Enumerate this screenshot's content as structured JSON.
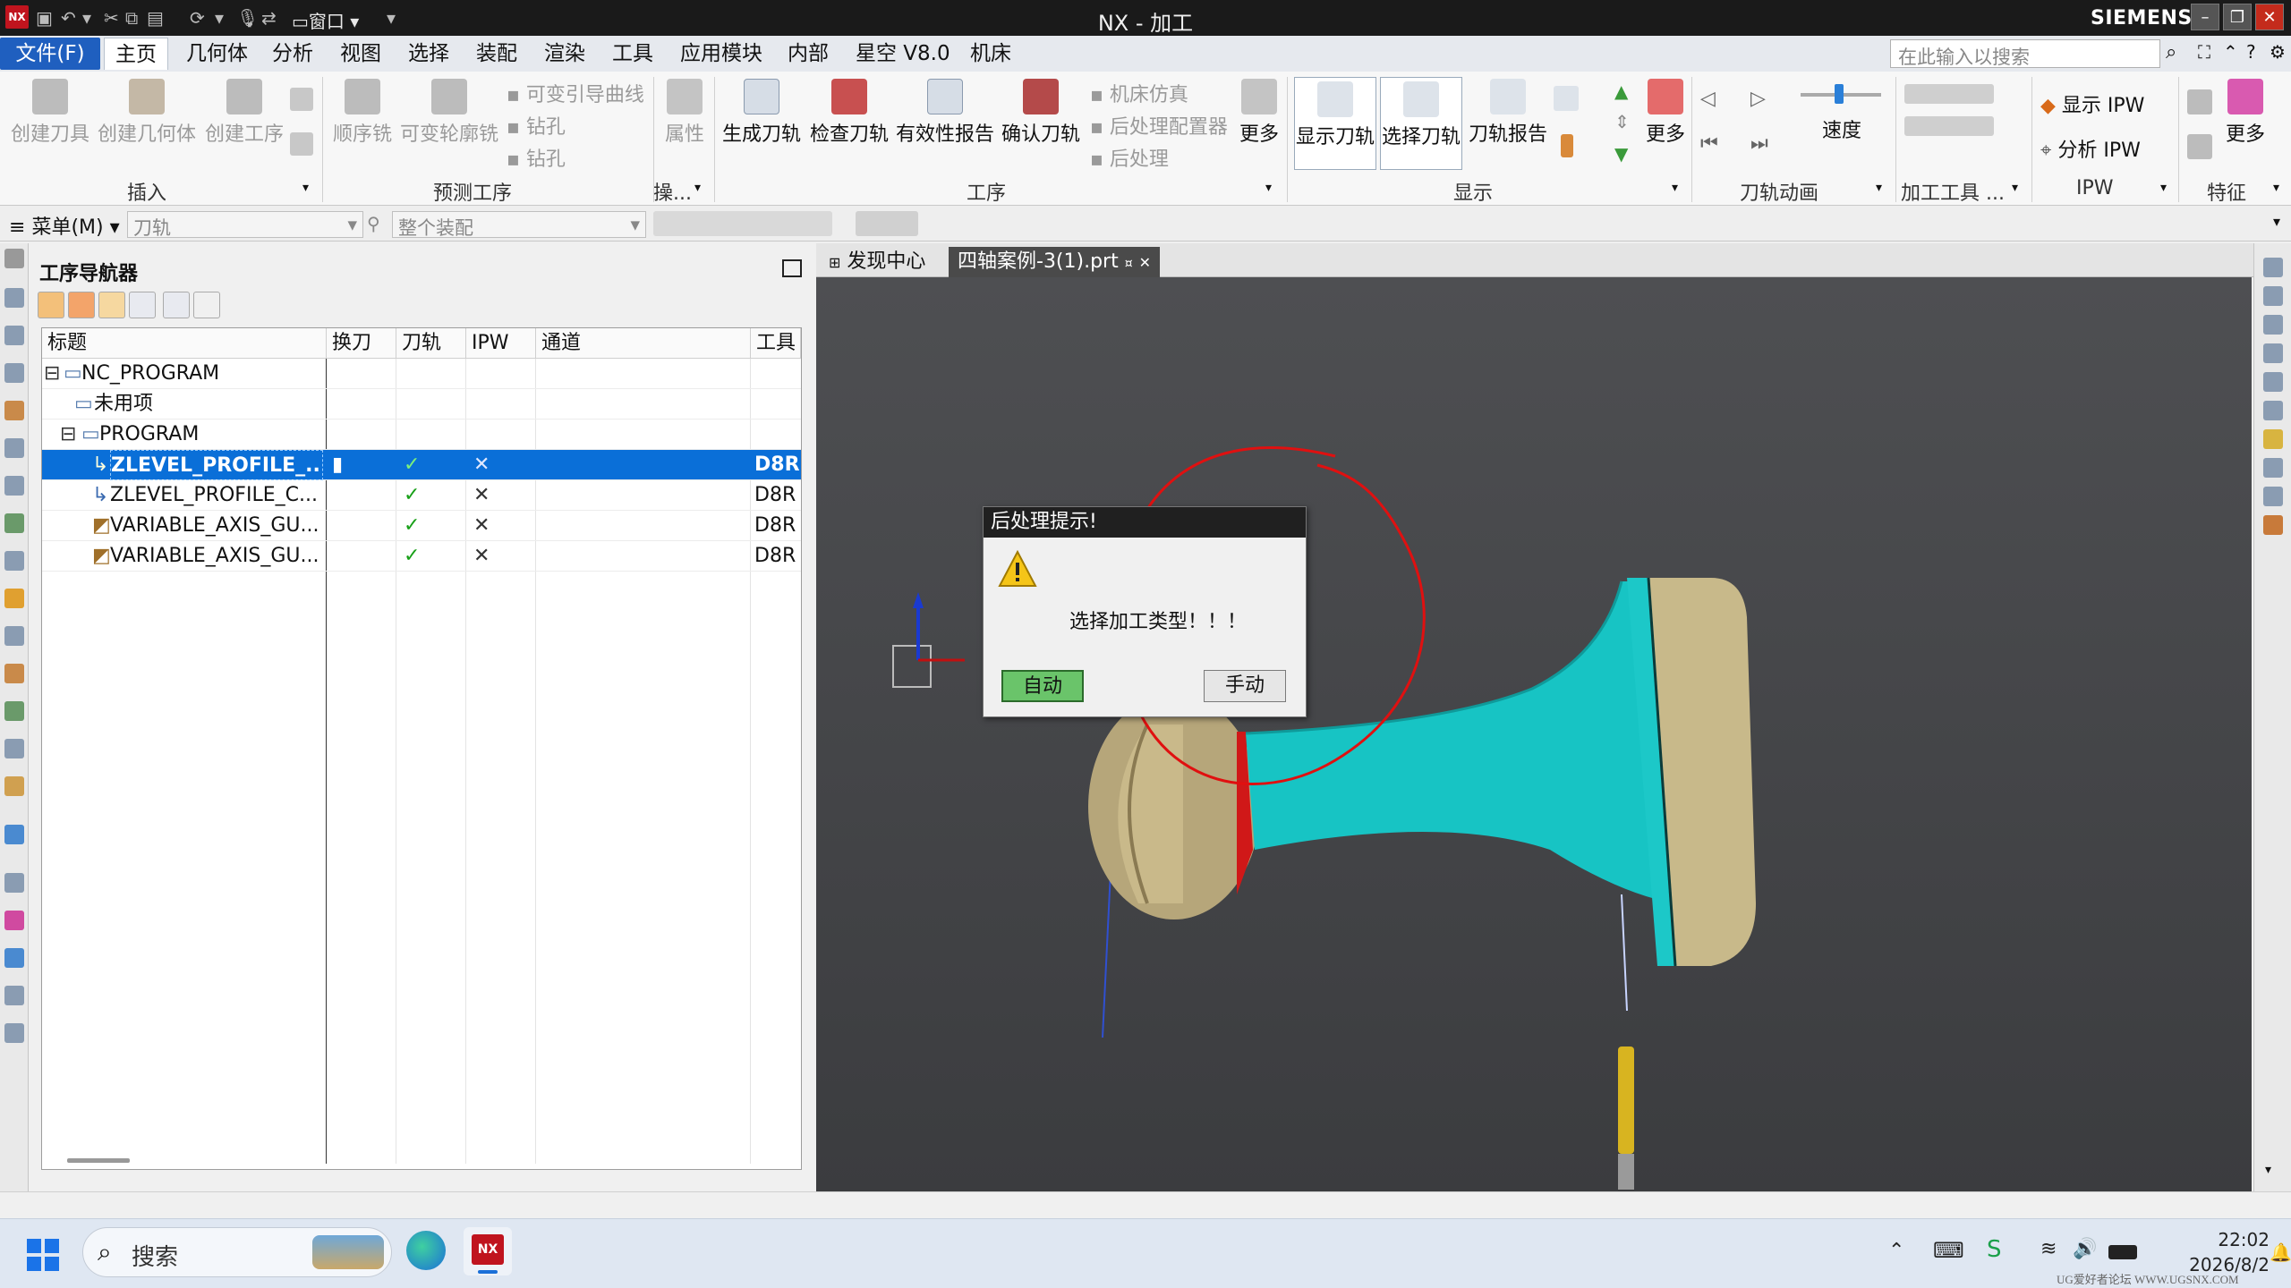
{
  "window": {
    "title": "NX - 加工",
    "brand": "SIEMENS",
    "window_menu": "窗口",
    "colors": {
      "file_tab": "#1f5fbf",
      "selection": "#0a6fd8",
      "titlebar": "#1a1a1a",
      "part_cyan": "#16c9c9",
      "part_gold": "#c8b98a",
      "annotation_red": "#e01010"
    }
  },
  "menu_tabs": [
    {
      "label": "文件(F)"
    },
    {
      "label": "主页"
    },
    {
      "label": "几何体"
    },
    {
      "label": "分析"
    },
    {
      "label": "视图"
    },
    {
      "label": "选择"
    },
    {
      "label": "装配"
    },
    {
      "label": "渲染"
    },
    {
      "label": "工具"
    },
    {
      "label": "应用模块"
    },
    {
      "label": "内部"
    },
    {
      "label": "星空 V8.0"
    },
    {
      "label": "机床"
    }
  ],
  "search": {
    "placeholder": "在此输入以搜索"
  },
  "ribbon": {
    "insert": {
      "create_tool": "创建刀具",
      "create_geometry": "创建几何体",
      "create_operation": "创建工序",
      "group": "插入"
    },
    "predict": {
      "sequential_mill": "顺序铣",
      "variable_contour": "可变轮廓铣",
      "var_streamline": "可变引导曲线",
      "drill1": "钻孔",
      "drill2": "钻孔",
      "group": "预测工序"
    },
    "ops": {
      "properties": "属性",
      "group": "操..."
    },
    "operation": {
      "generate": "生成刀轨",
      "verify": "检查刀轨",
      "validity_report": "有效性报告",
      "confirm": "确认刀轨",
      "machine_sim": "机床仿真",
      "postproc_config": "后处理配置器",
      "postprocess": "后处理",
      "more": "更多",
      "group": "工序"
    },
    "display": {
      "show_path": "显示刀轨",
      "select_path": "选择刀轨",
      "path_report": "刀轨报告",
      "more": "更多",
      "group": "显示"
    },
    "animation": {
      "speed": "速度",
      "group": "刀轨动画"
    },
    "tools": {
      "group": "加工工具 ..."
    },
    "ipw": {
      "show": "显示 IPW",
      "analyze": "分析 IPW",
      "group": "IPW"
    },
    "feature": {
      "more": "更多",
      "group": "特征"
    }
  },
  "toolbar2": {
    "menu": "菜单(M)",
    "filter": "刀轨",
    "scope": "整个装配"
  },
  "navigator": {
    "title": "工序导航器",
    "columns": [
      "标题",
      "换刀",
      "刀轨",
      "IPW",
      "通道",
      "工具"
    ],
    "rows": [
      {
        "name": "NC_PROGRAM",
        "tool_change": "",
        "path": "",
        "ipw": "",
        "channel": "",
        "tool": ""
      },
      {
        "name": "未用项",
        "tool_change": "",
        "path": "",
        "ipw": "",
        "channel": "",
        "tool": ""
      },
      {
        "name": "PROGRAM",
        "tool_change": "",
        "path": "",
        "ipw": "",
        "channel": "",
        "tool": ""
      },
      {
        "name": "ZLEVEL_PROFILE_...",
        "tool_change": "▮",
        "path": "✓",
        "ipw": "✕",
        "channel": "",
        "tool": "D8R"
      },
      {
        "name": "ZLEVEL_PROFILE_C...",
        "tool_change": "",
        "path": "✓",
        "ipw": "✕",
        "channel": "",
        "tool": "D8R"
      },
      {
        "name": "VARIABLE_AXIS_GU...",
        "tool_change": "",
        "path": "✓",
        "ipw": "✕",
        "channel": "",
        "tool": "D8R"
      },
      {
        "name": "VARIABLE_AXIS_GU...",
        "tool_change": "",
        "path": "✓",
        "ipw": "✕",
        "channel": "",
        "tool": "D8R"
      }
    ]
  },
  "viewport_tabs": [
    {
      "label": "发现中心"
    },
    {
      "label": "四轴案例-3(1).prt"
    }
  ],
  "dialog": {
    "title": "后处理提示!",
    "message": "选择加工类型！！！",
    "auto": "自动",
    "manual": "手动",
    "icon": "warning-icon"
  },
  "taskbar": {
    "search": "搜索",
    "time": "22:02",
    "date": "2026/8/2",
    "watermark": "UG爱好者论坛 WWW.UGSNX.COM"
  }
}
